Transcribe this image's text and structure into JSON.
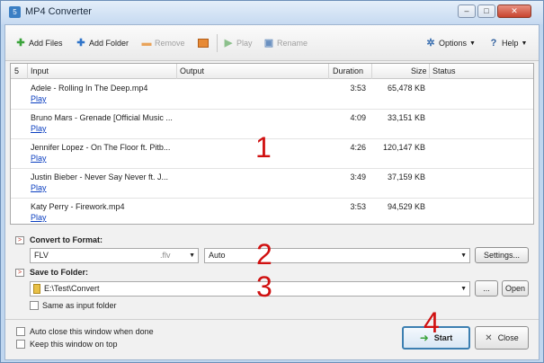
{
  "window": {
    "title": "MP4 Converter",
    "app_icon_glyph": "5",
    "min_glyph": "–",
    "max_glyph": "□",
    "close_glyph": "✕"
  },
  "toolbar": {
    "add_files": "Add Files",
    "add_folder": "Add Folder",
    "remove": "Remove",
    "play": "Play",
    "rename": "Rename",
    "options": "Options",
    "help": "Help",
    "icons": {
      "add_files": "plus-icon",
      "add_folder": "plus-icon",
      "remove": "minus-icon",
      "stop": "stop-icon",
      "play": "play-icon",
      "rename": "rename-icon",
      "options": "gear-icon",
      "help": "question-icon"
    }
  },
  "table": {
    "headers": {
      "index": "5",
      "input": "Input",
      "output": "Output",
      "duration": "Duration",
      "size": "Size",
      "status": "Status"
    },
    "play_label": "Play",
    "rows": [
      {
        "input": "Adele - Rolling In The Deep.mp4",
        "duration": "3:53",
        "size": "65,478 KB"
      },
      {
        "input": "Bruno Mars - Grenade [Official Music ...",
        "duration": "4:09",
        "size": "33,151 KB"
      },
      {
        "input": "Jennifer Lopez - On The Floor ft. Pitb...",
        "duration": "4:26",
        "size": "120,147 KB"
      },
      {
        "input": "Justin Bieber - Never Say Never ft. J...",
        "duration": "3:49",
        "size": "37,159 KB"
      },
      {
        "input": "Katy Perry - Firework.mp4",
        "duration": "3:53",
        "size": "94,529 KB"
      }
    ]
  },
  "convert": {
    "label": "Convert to Format:",
    "format": "FLV",
    "extension": ".flv",
    "preset": "Auto",
    "settings_button": "Settings..."
  },
  "save": {
    "label": "Save to Folder:",
    "path": "E:\\Test\\Convert",
    "browse_button": "...",
    "open_button": "Open",
    "same_as_input": "Same as input folder"
  },
  "bottom": {
    "auto_close": "Auto close this window when done",
    "keep_on_top": "Keep this window on top",
    "start_button": "Start",
    "close_button": "Close"
  },
  "annotations": {
    "n1": "1",
    "n2": "2",
    "n3": "3",
    "n4": "4"
  },
  "colors": {
    "annotation_red": "#d01010",
    "link_blue": "#0a3ec0",
    "start_button_border": "#3c7fb1",
    "title_bar": "#c6daf1"
  }
}
